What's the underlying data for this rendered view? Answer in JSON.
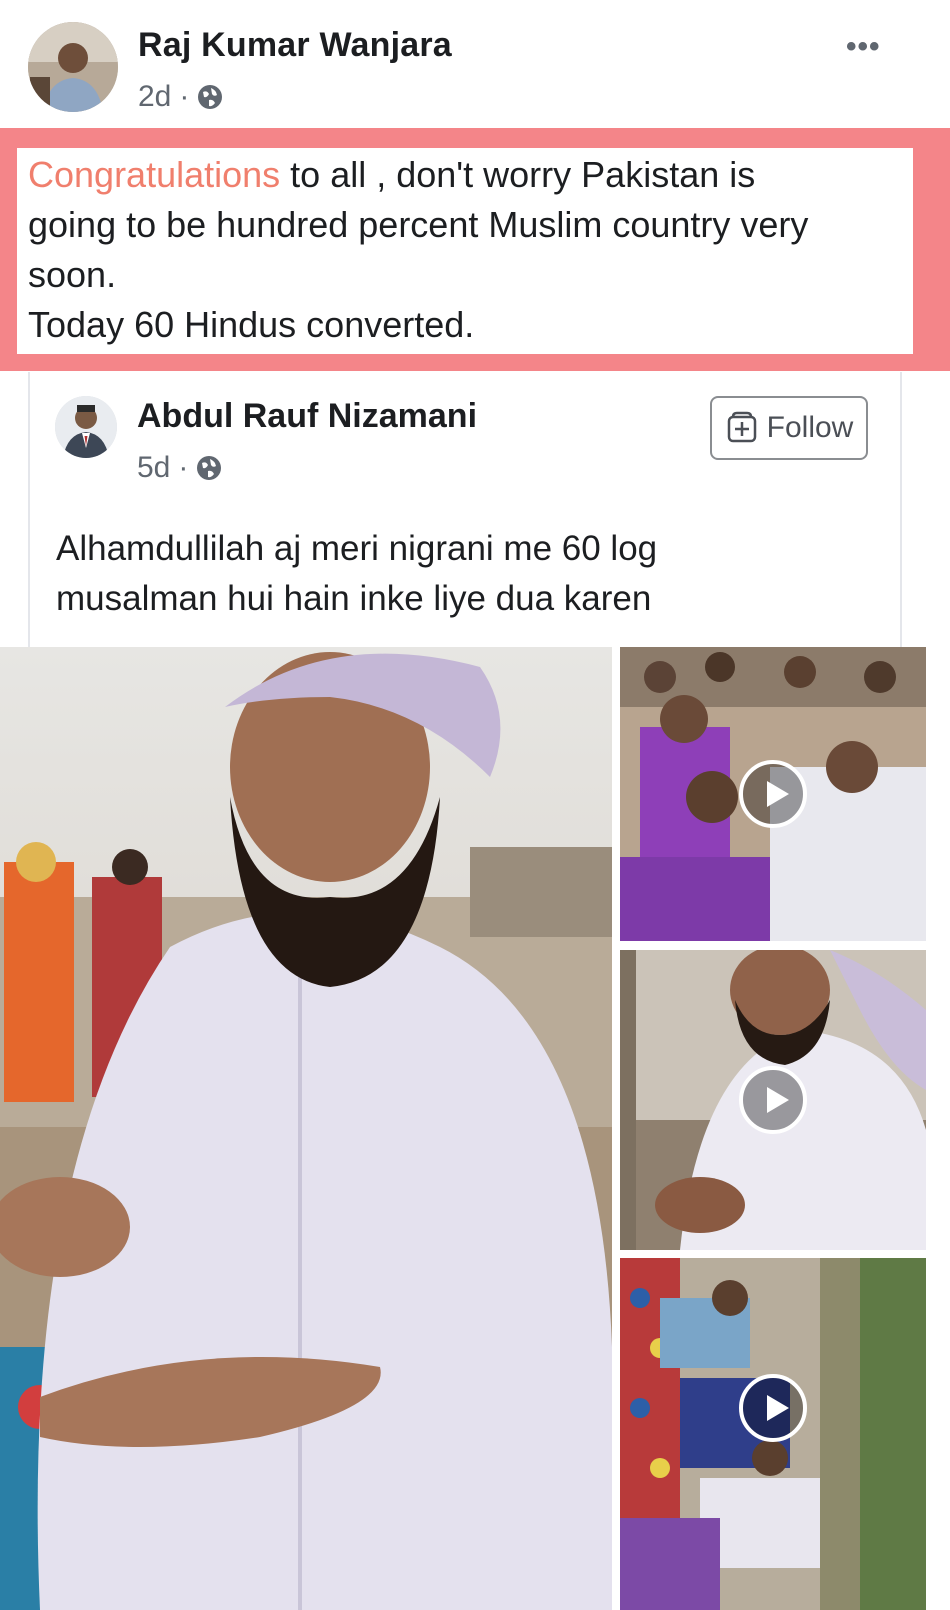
{
  "post": {
    "author": "Raj Kumar Wanjara",
    "time": "2d",
    "separator": "·",
    "more_icon": "•••",
    "text_accent": "Congratulations",
    "text_line1_rest": " to all , don't worry Pakistan is",
    "text_line2": "going to be hundred percent Muslim country very",
    "text_line3": "soon.",
    "text_line4": "Today 60 Hindus converted.",
    "highlight_color": "#f48589",
    "accent_color": "#f07f6d"
  },
  "shared": {
    "author": "Abdul Rauf Nizamani",
    "time": "5d",
    "separator": "·",
    "follow_label": "Follow",
    "text_line1": "Alhamdullilah aj meri nigrani me 60 log",
    "text_line2": "musalman hui hain inke liye dua karen"
  },
  "media": {
    "main_photo": "man-in-white-turban-photo",
    "thumbnails": [
      "crowd-video",
      "man-speaking-video",
      "gathering-video"
    ],
    "play_icon": "play-icon"
  }
}
